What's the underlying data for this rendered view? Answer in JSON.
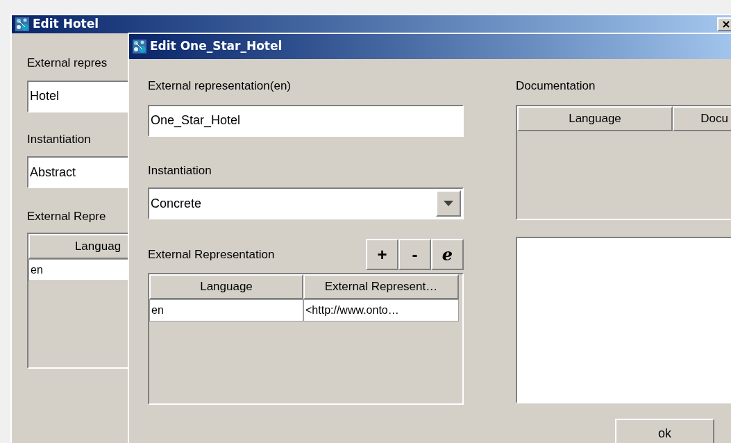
{
  "back_window": {
    "title": "Edit Hotel",
    "fields": [
      {
        "label": "External repres",
        "value": "Hotel"
      },
      {
        "label": "Instantiation",
        "value": "Abstract"
      }
    ],
    "table": {
      "label": "External Repre",
      "columns": [
        "Languag"
      ],
      "rows": [
        [
          "en"
        ]
      ]
    }
  },
  "front_window": {
    "title": "Edit One_Star_Hotel",
    "name_field": {
      "label": "External representation(en)",
      "value": "One_Star_Hotel"
    },
    "instantiation": {
      "label": "Instantiation",
      "value": "Concrete"
    },
    "external_representation": {
      "label": "External Representation",
      "buttons": [
        "+",
        "-",
        "e"
      ],
      "columns": [
        "Language",
        "External Represent…"
      ],
      "rows": [
        [
          "en",
          "<http://www.onto…"
        ]
      ]
    },
    "documentation": {
      "label": "Documentation",
      "columns": [
        "Language",
        "Docu"
      ]
    },
    "ok_button": "ok"
  }
}
